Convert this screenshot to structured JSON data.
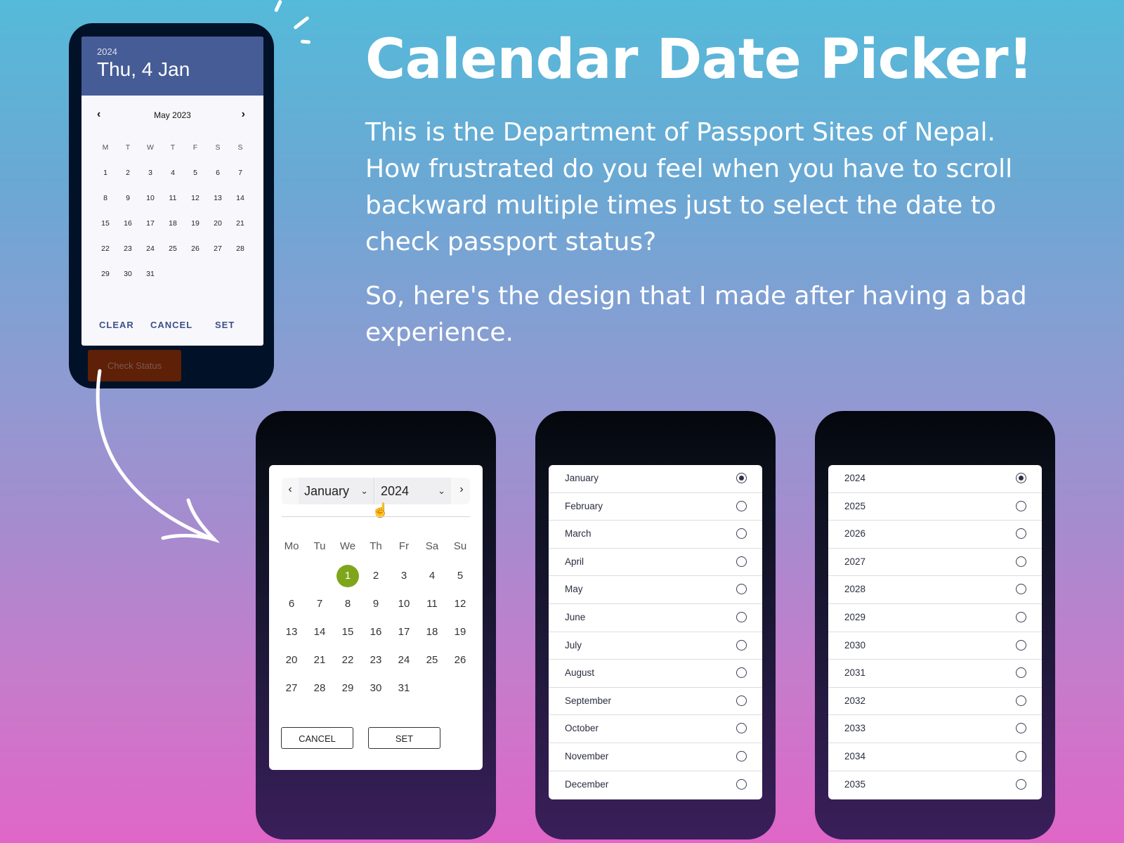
{
  "headline": {
    "title": "Calendar Date Picker!",
    "paragraph1": "This is the Department of Passport Sites of Nepal. How frustrated do you feel when you have to scroll backward multiple times just to select the date to check passport status?",
    "paragraph2": "So, here's the design that I made after having a bad experience."
  },
  "old_picker": {
    "header_year": "2024",
    "header_date": "Thu, 4 Jan",
    "month_label": "May 2023",
    "prev_icon": "chevron-left-icon",
    "next_icon": "chevron-right-icon",
    "weekdays": [
      "M",
      "T",
      "W",
      "T",
      "F",
      "S",
      "S"
    ],
    "days": [
      "1",
      "2",
      "3",
      "4",
      "5",
      "6",
      "7",
      "8",
      "9",
      "10",
      "11",
      "12",
      "13",
      "14",
      "15",
      "16",
      "17",
      "18",
      "19",
      "20",
      "21",
      "22",
      "23",
      "24",
      "25",
      "26",
      "27",
      "28",
      "29",
      "30",
      "31"
    ],
    "actions": {
      "clear": "CLEAR",
      "cancel": "CANCEL",
      "set": "SET"
    },
    "check_status": "Check Status",
    "accent_color": "#465c96",
    "button_color": "#5e2006"
  },
  "new_picker": {
    "month_select": "January",
    "year_select": "2024",
    "weekdays": [
      "Mo",
      "Tu",
      "We",
      "Th",
      "Fr",
      "Sa",
      "Su"
    ],
    "leading_blanks": 2,
    "days": [
      "1",
      "2",
      "3",
      "4",
      "5",
      "6",
      "7",
      "8",
      "9",
      "10",
      "11",
      "12",
      "13",
      "14",
      "15",
      "16",
      "17",
      "18",
      "19",
      "20",
      "21",
      "22",
      "23",
      "24",
      "25",
      "26",
      "27",
      "28",
      "29",
      "30",
      "31"
    ],
    "selected_day": "1",
    "selected_color": "#7fa61b",
    "cancel": "CANCEL",
    "set": "SET"
  },
  "month_list": {
    "selected": "January",
    "items": [
      "January",
      "February",
      "March",
      "April",
      "May",
      "June",
      "July",
      "August",
      "September",
      "October",
      "November",
      "December"
    ]
  },
  "year_list": {
    "selected": "2024",
    "items": [
      "2024",
      "2025",
      "2026",
      "2027",
      "2028",
      "2029",
      "2030",
      "2031",
      "2032",
      "2033",
      "2034",
      "2035"
    ]
  }
}
